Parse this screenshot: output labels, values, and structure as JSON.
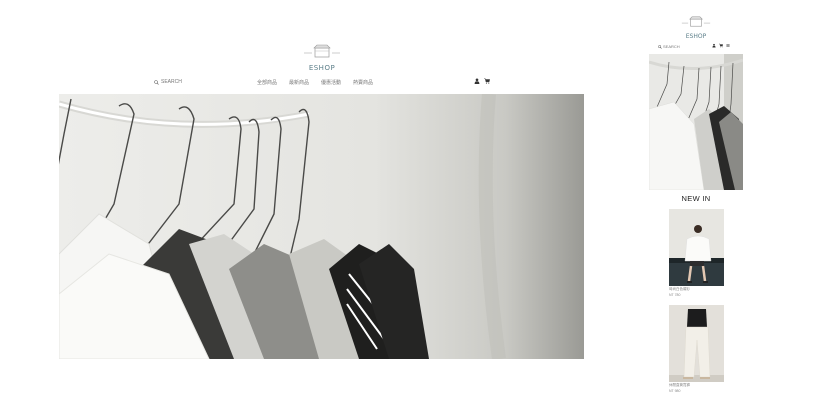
{
  "brand": {
    "name": "ESHOP"
  },
  "desktop": {
    "search_label": "SEARCH",
    "nav_items": [
      "全部商品",
      "最新商品",
      "優惠活動",
      "熱賣商品"
    ],
    "icons": [
      "search-icon",
      "user-icon",
      "cart-icon"
    ]
  },
  "mobile": {
    "search_label": "SEARCH",
    "icons": [
      "search-icon",
      "user-icon",
      "cart-icon",
      "menu-icon"
    ],
    "section_title": "NEW IN",
    "products": [
      {
        "name": "時尚白色襯衫",
        "price": "NT 780"
      },
      {
        "name": "休閒直筒寬褲",
        "price": "NT 980"
      }
    ]
  },
  "colors": {
    "brand": "#5d7f8a",
    "background": "#ffffff"
  }
}
